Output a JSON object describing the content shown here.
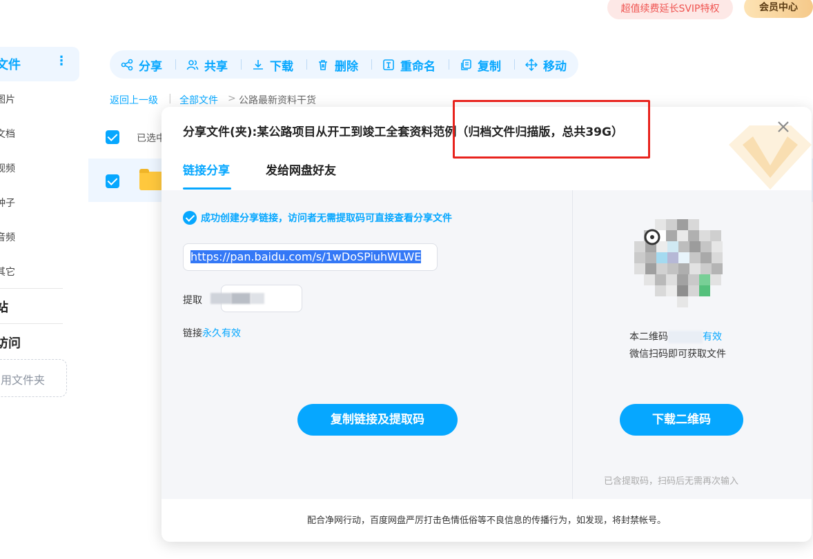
{
  "topbar": {
    "svip_promo": "超值续费延长SVIP特权",
    "vip_center": "会员中心"
  },
  "sidebar": {
    "active_label": "文件",
    "items": [
      "图片",
      "文档",
      "视频",
      "种子",
      "音频",
      "其它"
    ],
    "sections": [
      "站",
      "访问"
    ],
    "dashed_label": "用文件夹"
  },
  "toolbar": {
    "share": "分享",
    "co_share": "共享",
    "download": "下载",
    "delete": "删除",
    "rename": "重命名",
    "copy": "复制",
    "move": "移动"
  },
  "breadcrumb": {
    "back": "返回上一级",
    "sep": "|",
    "all_files": "全部文件",
    "arrow": ">",
    "current": "公路最新资料干货"
  },
  "list": {
    "selected_prefix": "已选中"
  },
  "dialog": {
    "title": "分享文件(夹):某公路项目从开工到竣工全套资料范例（归档文件归描版，总共39G）",
    "close": "✕",
    "tabs": {
      "link_share": "链接分享",
      "send_friend": "发给网盘好友"
    },
    "success_msg": "成功创建分享链接，访问者无需提取码可直接查看分享文件",
    "link": "https://pan.baidu.com/s/1wDoSPiuhWLWE",
    "code_label": "提取",
    "validity_prefix": "链接",
    "validity_value": "永久有效",
    "copy_button": "复制链接及提取码",
    "qr_note_prefix": "本二维码",
    "qr_note_value": "有效",
    "qr_note_line2": "微信扫码即可获取文件",
    "download_qr_button": "下载二维码",
    "qr_hint": "已含提取码，扫码后无需再次输入",
    "footer": "配合净网行动，百度网盘严厉打击色情低俗等不良信息的传播行为，如发现，将封禁帐号。"
  },
  "colors": {
    "accent": "#06a7ff",
    "annotation_red": "#e8231d"
  }
}
